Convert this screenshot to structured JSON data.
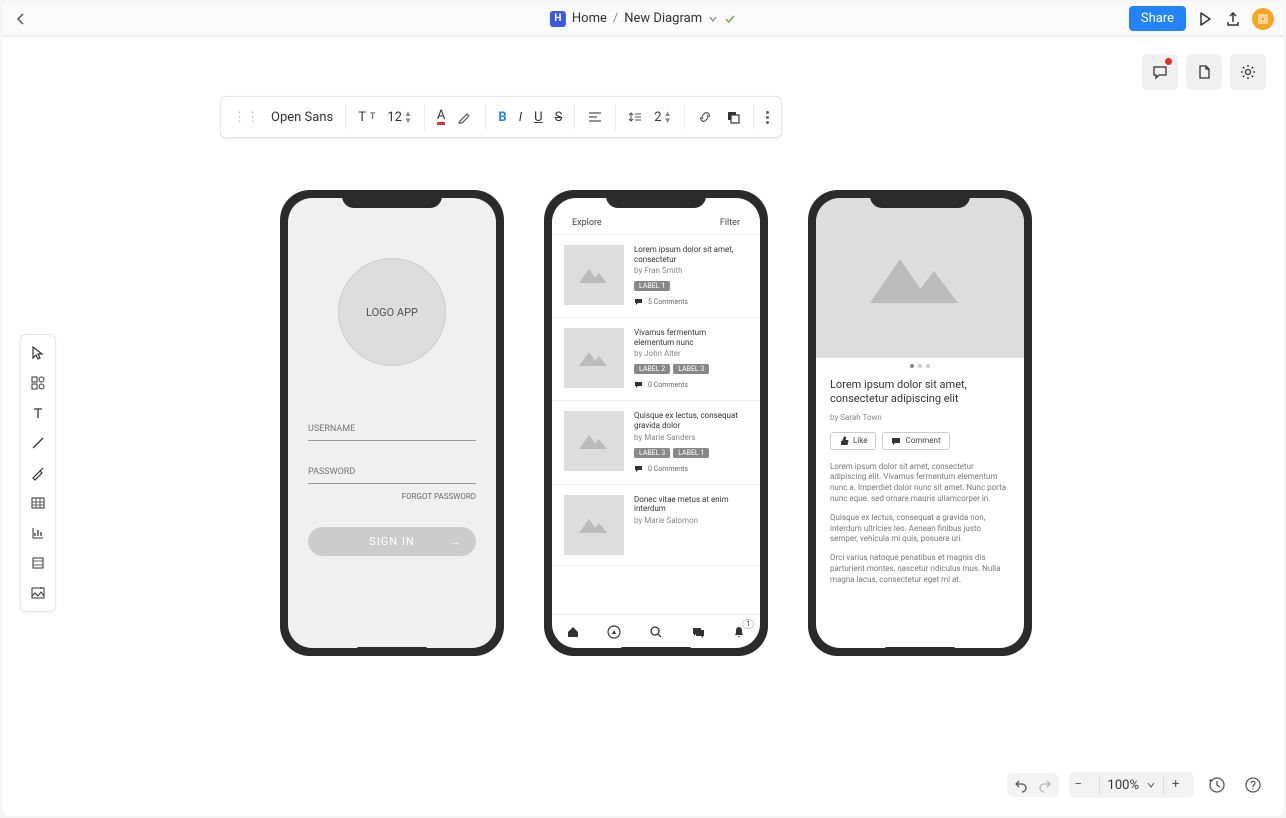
{
  "header": {
    "home": "Home",
    "diagram_name": "New Diagram",
    "share": "Share"
  },
  "toolbar": {
    "font": "Open Sans",
    "font_size": "12",
    "line_height": "2"
  },
  "status": {
    "zoom": "100%"
  },
  "phone1": {
    "logo": "LOGO APP",
    "username": "USERNAME",
    "password": "PASSWORD",
    "forgot": "FORGOT PASSWORD",
    "signin": "SIGN IN"
  },
  "phone2": {
    "tab_explore": "Explore",
    "tab_filter": "Filter",
    "notif_badge": "1",
    "items": [
      {
        "title": "Lorem ipsum dolor sit amet, consectetur",
        "author": "by Fran Smith",
        "labels": [
          "LABEL 1"
        ],
        "comments": "5 Comments"
      },
      {
        "title": "Vivamus fermentum elementum nunc",
        "author": "by John Alter",
        "labels": [
          "LABEL 2",
          "LABEL 3"
        ],
        "comments": "0 Comments"
      },
      {
        "title": "Quisque ex lectus, consequat gravida dolor",
        "author": "by Marie Sanders",
        "labels": [
          "LABEL 3",
          "LABEL 1"
        ],
        "comments": "0 Comments"
      },
      {
        "title": "Donec vitae metus at enim interdum",
        "author": "by Marie Salomon",
        "labels": [],
        "comments": ""
      }
    ]
  },
  "phone3": {
    "title": "Lorem ipsum dolor sit amet, consectetur adipiscing elit",
    "author": "by Sarah Town",
    "like": "Like",
    "comment": "Comment",
    "p1": "Lorem ipsum dolor sit amet, consectetur adipiscing elit. Vivamus fermentum elementum nunc a. Imperdiet dolor nunc sit amet. Nunc porta nunc eque. sed ornare mauris ullamcorper in.",
    "p2": "Quisque ex lectus, consequat a gravida non, interdum ultricies leo. Aenean finibus justo semper, vehicula mi quis, posuere uri.",
    "p3": "Orci varius natoque penatibus et magnis dis parturient montes, nascetur ridiculus mus. Nulla magna lacus, consectetur eget mi at."
  }
}
